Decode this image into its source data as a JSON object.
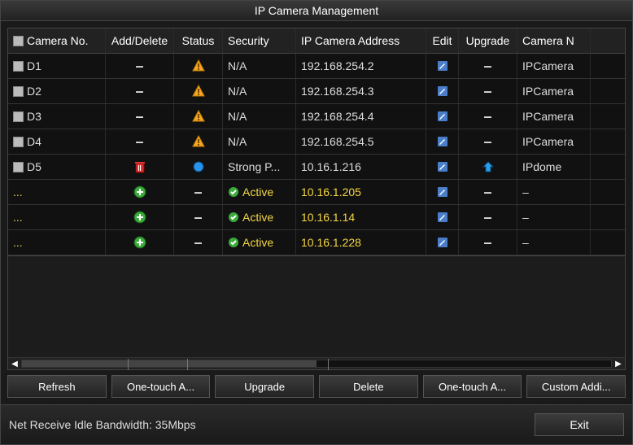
{
  "window": {
    "title": "IP Camera Management"
  },
  "columns": {
    "camera_no": "Camera No.",
    "add_delete": "Add/Delete",
    "status": "Status",
    "security": "Security",
    "ip": "IP Camera Address",
    "edit": "Edit",
    "upgrade": "Upgrade",
    "camera_name": "Camera N"
  },
  "rows": [
    {
      "no": "D1",
      "checkbox": true,
      "ad_icon": "dash",
      "status_icon": "warn",
      "security": "N/A",
      "ip": "192.168.254.2",
      "edit_icon": "edit",
      "upgrade_icon": "dash",
      "name": "IPCamera"
    },
    {
      "no": "D2",
      "checkbox": true,
      "ad_icon": "dash",
      "status_icon": "warn",
      "security": "N/A",
      "ip": "192.168.254.3",
      "edit_icon": "edit",
      "upgrade_icon": "dash",
      "name": "IPCamera"
    },
    {
      "no": "D3",
      "checkbox": true,
      "ad_icon": "dash",
      "status_icon": "warn",
      "security": "N/A",
      "ip": "192.168.254.4",
      "edit_icon": "edit",
      "upgrade_icon": "dash",
      "name": "IPCamera"
    },
    {
      "no": "D4",
      "checkbox": true,
      "ad_icon": "dash",
      "status_icon": "warn",
      "security": "N/A",
      "ip": "192.168.254.5",
      "edit_icon": "edit",
      "upgrade_icon": "dash",
      "name": "IPCamera"
    },
    {
      "no": "D5",
      "checkbox": true,
      "ad_icon": "trash",
      "status_icon": "dot-blue",
      "security": "Strong P...",
      "ip": "10.16.1.216",
      "edit_icon": "edit",
      "upgrade_icon": "up-arrow",
      "name": "IPdome"
    },
    {
      "no": "...",
      "checkbox": false,
      "no_class": "ellipsis-yellow",
      "ad_icon": "plus",
      "status_icon": "dash",
      "security": "Active",
      "security_icon": "check",
      "ip": "10.16.1.205",
      "ip_class": "active-text",
      "edit_icon": "edit",
      "upgrade_icon": "dash",
      "name": "–"
    },
    {
      "no": "...",
      "checkbox": false,
      "no_class": "ellipsis-yellow",
      "ad_icon": "plus",
      "status_icon": "dash",
      "security": "Active",
      "security_icon": "check",
      "ip": "10.16.1.14",
      "ip_class": "active-text",
      "edit_icon": "edit",
      "upgrade_icon": "dash",
      "name": "–"
    },
    {
      "no": "...",
      "checkbox": false,
      "no_class": "ellipsis-yellow",
      "ad_icon": "plus",
      "status_icon": "dash",
      "security": "Active",
      "security_icon": "check",
      "ip": "10.16.1.228",
      "ip_class": "active-text",
      "edit_icon": "edit",
      "upgrade_icon": "dash",
      "name": "–"
    }
  ],
  "buttons": {
    "refresh": "Refresh",
    "one_touch_add": "One-touch A...",
    "upgrade": "Upgrade",
    "delete": "Delete",
    "one_touch_activate": "One-touch A...",
    "custom_add": "Custom Addi..."
  },
  "footer": {
    "bandwidth": "Net Receive Idle Bandwidth: 35Mbps",
    "exit": "Exit"
  }
}
